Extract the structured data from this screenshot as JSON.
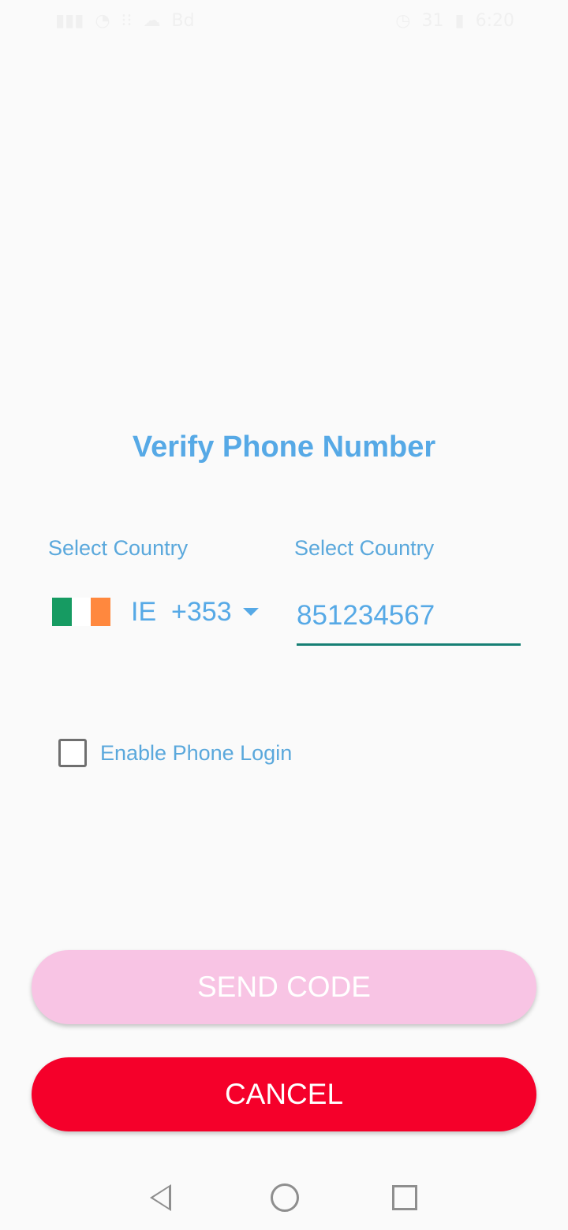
{
  "status_bar": {
    "left_text": "Bd",
    "right_text": "31",
    "time": "6:20"
  },
  "title": "Verify Phone Number",
  "country_label": "Select Country",
  "phone_label": "Select Country",
  "country": {
    "code": "IE",
    "dial_code": "+353",
    "flag_colors": [
      "#169b62",
      "#ffffff",
      "#ff883e"
    ]
  },
  "phone_number": "851234567",
  "checkbox": {
    "label": "Enable Phone Login",
    "checked": false
  },
  "buttons": {
    "send_code": "SEND CODE",
    "cancel": "CANCEL"
  },
  "navigation": {
    "back": "back-icon",
    "home": "home-icon",
    "recents": "recents-icon"
  }
}
